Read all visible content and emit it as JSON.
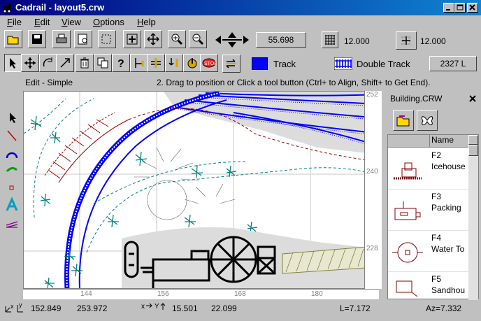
{
  "window": {
    "title": "Cadrail - layout5.crw"
  },
  "menu": [
    {
      "label": "File",
      "u": "F",
      "rest": "ile"
    },
    {
      "label": "Edit",
      "u": "E",
      "rest": "dit"
    },
    {
      "label": "View",
      "u": "V",
      "rest": "iew"
    },
    {
      "label": "Options",
      "u": "O",
      "rest": "ptions"
    },
    {
      "label": "Help",
      "u": "H",
      "rest": "elp"
    }
  ],
  "toolbar1": {
    "position_value": "55.698",
    "grid_value": "12.000",
    "snap_value": "12.000"
  },
  "toolbar2": {
    "track_label": "Track",
    "double_track_label": "Double Track",
    "length_value": "2327 L",
    "track_color": "#0000ff"
  },
  "hint": {
    "mode": "Edit - Simple",
    "message": "2. Drag to position or Click a tool button (Ctrl+ to Align, Shift+ to Get End)."
  },
  "rulers": {
    "right": [
      "252",
      "240",
      "228"
    ],
    "bottom": [
      "144",
      "156",
      "168",
      "180"
    ]
  },
  "library": {
    "title": "Building.CRW",
    "column_header": "Name",
    "items": [
      {
        "code": "F2",
        "name": "Icehouse"
      },
      {
        "code": "F3",
        "name": "Packing"
      },
      {
        "code": "F4",
        "name": "Water To"
      },
      {
        "code": "F5",
        "name": "Sandhou"
      }
    ]
  },
  "status": {
    "x": "152.849",
    "y": "253.972",
    "dx": "15.501",
    "dy": "22.099",
    "length": "L=7.172",
    "azimuth": "Az=7.332"
  }
}
